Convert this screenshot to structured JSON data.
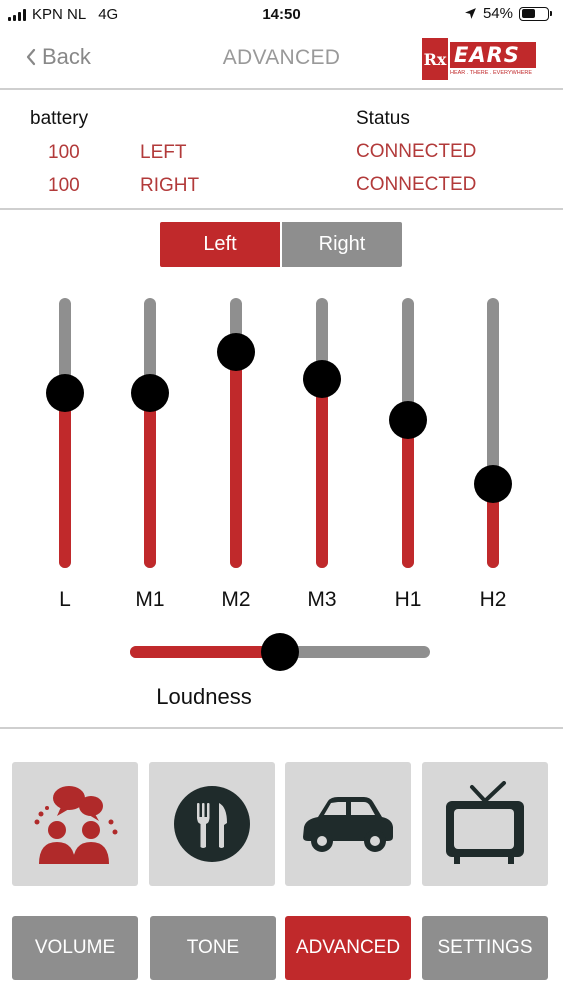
{
  "status_bar": {
    "carrier": "KPN NL",
    "network": "4G",
    "time": "14:50",
    "battery_percent": "54%",
    "battery_level": 0.54
  },
  "nav": {
    "back_label": "Back",
    "title": "ADVANCED",
    "logo": {
      "rx": "Rx",
      "word": "EARS",
      "tagline": "HEAR . THERE . EVERYWHERE"
    }
  },
  "info": {
    "battery_header": "battery",
    "status_header": "Status",
    "rows": [
      {
        "battery": "100",
        "side": "LEFT",
        "status": "CONNECTED"
      },
      {
        "battery": "100",
        "side": "RIGHT",
        "status": "CONNECTED"
      }
    ]
  },
  "segment": {
    "left_label": "Left",
    "right_label": "Right",
    "selected": "Left"
  },
  "equalizer": {
    "bands": [
      {
        "label": "L",
        "level": 0.65
      },
      {
        "label": "M1",
        "level": 0.65
      },
      {
        "label": "M2",
        "level": 0.8
      },
      {
        "label": "M3",
        "level": 0.7
      },
      {
        "label": "H1",
        "level": 0.55
      },
      {
        "label": "H2",
        "level": 0.31
      }
    ]
  },
  "loudness": {
    "label": "Loudness",
    "level": 0.5
  },
  "programs": [
    {
      "icon": "conversation-icon"
    },
    {
      "icon": "restaurant-icon"
    },
    {
      "icon": "car-icon"
    },
    {
      "icon": "tv-icon"
    }
  ],
  "tabs": [
    {
      "label": "VOLUME",
      "active": false
    },
    {
      "label": "TONE",
      "active": false
    },
    {
      "label": "ADVANCED",
      "active": true
    },
    {
      "label": "SETTINGS",
      "active": false
    }
  ],
  "colors": {
    "accent": "#c0292b",
    "inactive": "#8e8e8e",
    "text_red": "#b23a3a"
  }
}
